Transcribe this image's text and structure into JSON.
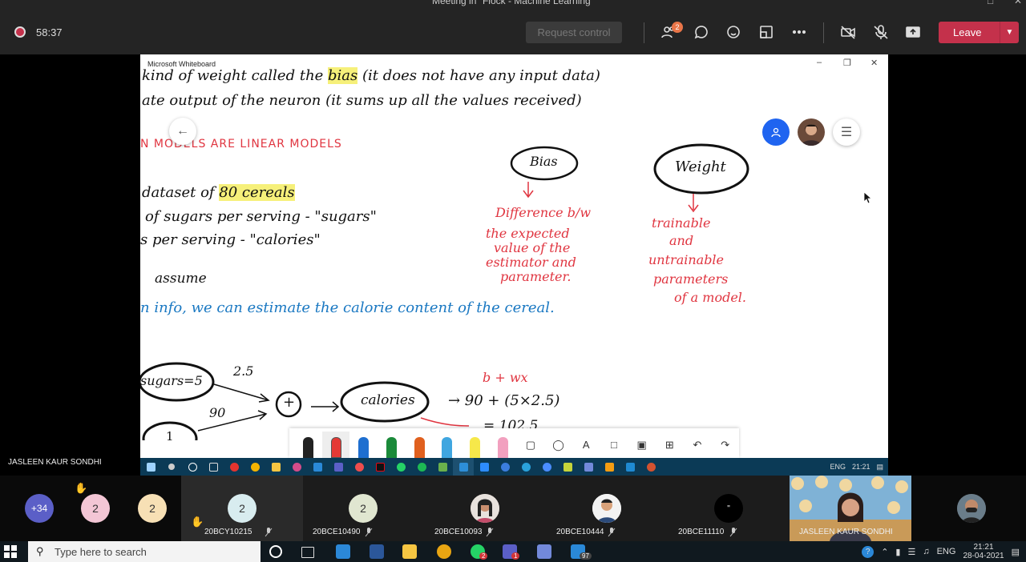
{
  "meeting": {
    "title": "Meeting in \"Flock - Machine Learning\"",
    "timer": "58:37",
    "request_control": "Request control",
    "participants_badge": "2",
    "leave_label": "Leave"
  },
  "whiteboard": {
    "app_title": "Microsoft Whiteboard",
    "ink": {
      "line1a": "kind of weight called the ",
      "line1_hl": "bias",
      "line1b": " (it does not have any input data)",
      "line2": "ate output of the neuron (it sums up all the values received)",
      "heading": "N MODELS ARE LINEAR MODELS",
      "dataset_a": "dataset of ",
      "dataset_hl": "80 cereals",
      "sugars": "of sugars per serving - \"sugars\"",
      "calories": "s per serving - \"calories\"",
      "assume": "assume",
      "blue_line": "n info, we can estimate the calorie content of the cereal.",
      "bias_circle": "Bias",
      "weight_circle": "Weight",
      "bias_desc": [
        "Difference b/w",
        "the expected",
        "value of the",
        "estimator and",
        "parameter."
      ],
      "weight_desc": [
        "trainable",
        "and",
        "untrainable",
        "parameters",
        "of a model."
      ],
      "sugars_node": "sugars=5",
      "val_25": "2.5",
      "val_90": "90",
      "plus": "+",
      "calories_node": "calories",
      "formula_red": "b + wx",
      "formula": "→ 90 + (5×2.5)",
      "eq": "= 102.5",
      "one_node": "1"
    }
  },
  "shared_taskbar": {
    "lang": "ENG",
    "time": "21:21"
  },
  "presenter_name": "JASLEEN KAUR SONDHI",
  "participants": [
    {
      "label": "+34",
      "name": ""
    },
    {
      "label": "2",
      "name": ""
    },
    {
      "label": "2",
      "name": ""
    },
    {
      "label": "2",
      "name": "20BCY10215"
    },
    {
      "label": "2",
      "name": "20BCE10490"
    },
    {
      "label": "",
      "name": "20BCE10093"
    },
    {
      "label": "",
      "name": "20BCE10444"
    },
    {
      "label": "\"",
      "name": "20BCE11110"
    },
    {
      "label": "",
      "name": "JASLEEN KAUR SONDHI"
    },
    {
      "label": "",
      "name": ""
    }
  ],
  "windows": {
    "search_placeholder": "Type here to search",
    "lang": "ENG",
    "time": "21:21",
    "date": "28-04-2021",
    "whatsapp_badge": "2",
    "teams_badge": "1",
    "mail_badge": "97"
  },
  "colors": {
    "leave": "#c4314b",
    "ink_red": "#e03540",
    "ink_blue": "#1a78c2",
    "highlight": "#f6f07a"
  }
}
